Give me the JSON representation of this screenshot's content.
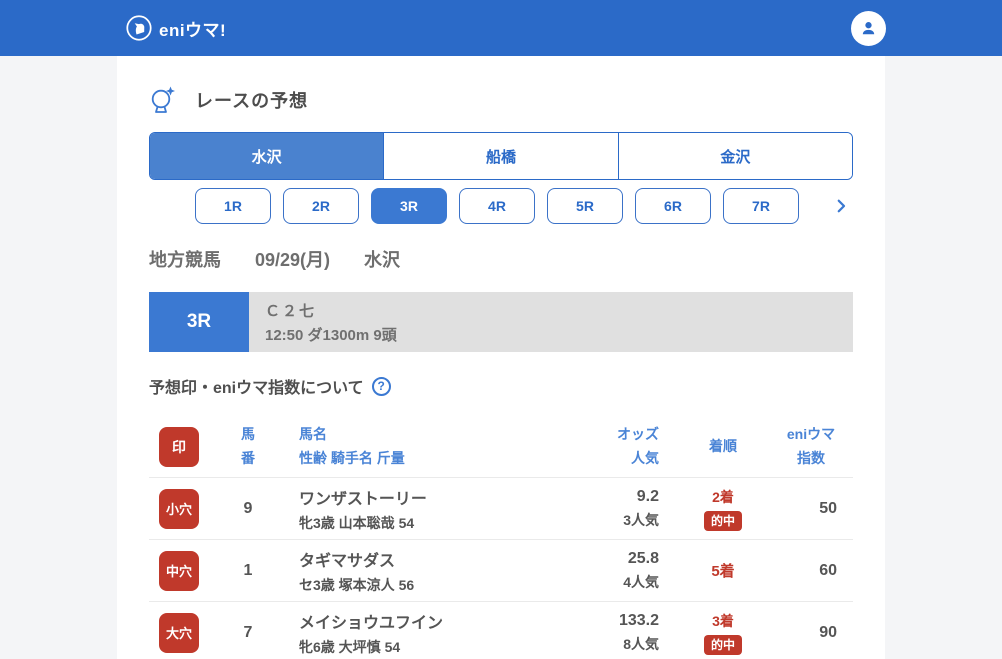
{
  "header": {
    "logo_text": "eniウマ!"
  },
  "page": {
    "section_title": "レースの予想"
  },
  "venue_tabs": [
    {
      "label": "水沢",
      "selected": true
    },
    {
      "label": "船橋",
      "selected": false
    },
    {
      "label": "金沢",
      "selected": false
    }
  ],
  "race_tabs": {
    "items": [
      {
        "label": "1R",
        "selected": false
      },
      {
        "label": "2R",
        "selected": false
      },
      {
        "label": "3R",
        "selected": true
      },
      {
        "label": "4R",
        "selected": false
      },
      {
        "label": "5R",
        "selected": false
      },
      {
        "label": "6R",
        "selected": false
      },
      {
        "label": "7R",
        "selected": false
      }
    ]
  },
  "race_meta": {
    "category": "地方競馬",
    "date": "09/29(月)",
    "venue": "水沢"
  },
  "race_banner": {
    "race_no": "3R",
    "race_class": "Ｃ２七",
    "race_details": "12:50 ダ1300m 9頭"
  },
  "about_link": {
    "label": "予想印・eniウマ指数について",
    "help_glyph": "?"
  },
  "table": {
    "headers": {
      "mark": "印",
      "horse_no": [
        "馬",
        "番"
      ],
      "horse_info": [
        "馬名",
        "性齢 騎手名 斤量"
      ],
      "odds": [
        "オッズ",
        "人気"
      ],
      "result": "着順",
      "index": [
        "eniウマ",
        "指数"
      ]
    },
    "rows": [
      {
        "mark": "小穴",
        "horse_no": "9",
        "horse_name": "ワンザストーリー",
        "horse_detail": "牝3歳 山本聡哉 54",
        "odds": "9.2",
        "popularity": "3人気",
        "result": "2着",
        "hit": "的中",
        "index": "50"
      },
      {
        "mark": "中穴",
        "horse_no": "1",
        "horse_name": "タギマサダス",
        "horse_detail": "セ3歳 塚本涼人 56",
        "odds": "25.8",
        "popularity": "4人気",
        "result": "5着",
        "index": "60"
      },
      {
        "mark": "大穴",
        "horse_no": "7",
        "horse_name": "メイショウユフイン",
        "horse_detail": "牝6歳 大坪慎 54",
        "odds": "133.2",
        "popularity": "8人気",
        "result": "3着",
        "hit": "的中",
        "index": "90"
      }
    ]
  },
  "colors": {
    "header-blue": "#2b6ac8",
    "tab-blue": "#4a82cf",
    "accent-blue": "#3b79d2",
    "table-header-blue": "#4a84d6",
    "badge-red": "#c0392b",
    "text-dark": "#555555",
    "text-gray": "#6e6e6e",
    "banner-gray": "#e0e0e0",
    "page-bg": "#f4f5f7",
    "border-gray": "#eaeaea"
  }
}
